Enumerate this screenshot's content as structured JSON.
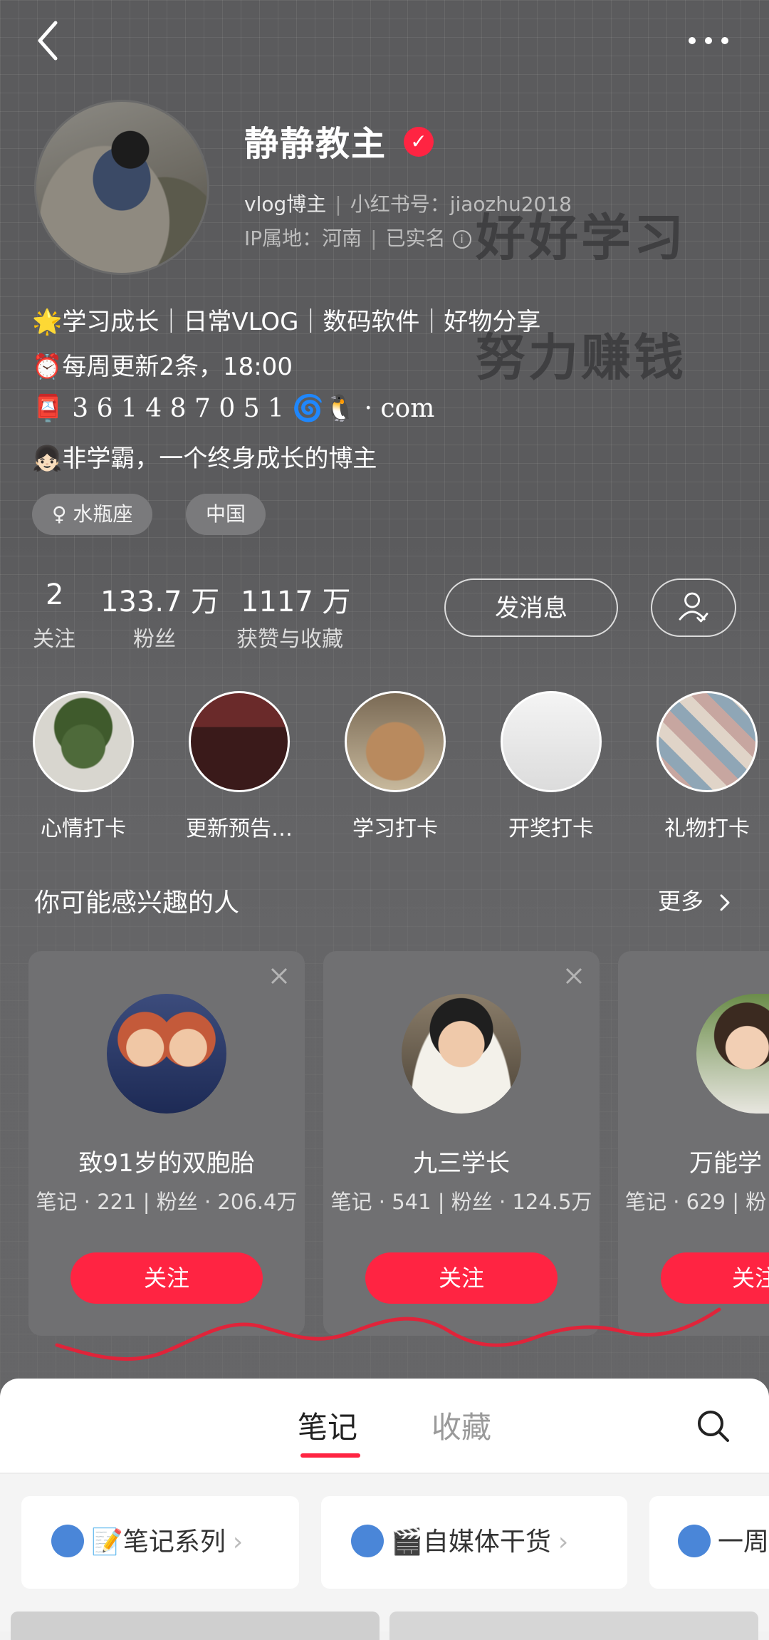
{
  "header": {
    "back_icon": "chevron-left-icon",
    "more_icon": "more-dots-icon"
  },
  "profile": {
    "name": "静静教主",
    "verified_icon": "verified-check-icon",
    "role": "vlog博主",
    "xhs_id_label": "小红书号：jiaozhu2018",
    "ip_label": "IP属地：河南",
    "realname": "已实名",
    "info_icon": "info-circle-icon",
    "background_text_1": "好好学习",
    "background_text_2": "努力赚钱",
    "bio": [
      "🌟学习成长｜日常VLOG｜数码软件｜好物分享",
      "⏰每周更新2条，18:00",
      "📮 3 6 1 4 8 7 0 5 1 🌀🐧 · com",
      "👧🏻非学霸，一个终身成长的博主"
    ],
    "tags": [
      "♀ 水瓶座",
      "中国"
    ]
  },
  "stats": [
    {
      "value": "2",
      "label": "关注"
    },
    {
      "value": "133.7 万",
      "label": "粉丝"
    },
    {
      "value": "1117 万",
      "label": "获赞与收藏"
    }
  ],
  "actions": {
    "message_label": "发消息",
    "follow_icon": "user-check-icon"
  },
  "highlights": [
    {
      "label": "心情打卡"
    },
    {
      "label": "更新预告…"
    },
    {
      "label": "学习打卡"
    },
    {
      "label": "开奖打卡"
    },
    {
      "label": "礼物打卡"
    }
  ],
  "recommend": {
    "title": "你可能感兴趣的人",
    "more_label": "更多",
    "cards": [
      {
        "name": "致91岁的双胞胎",
        "stats": "笔记 · 221 | 粉丝 · 206.4万",
        "button": "关注"
      },
      {
        "name": "九三学长",
        "stats": "笔记 · 541 | 粉丝 · 124.5万",
        "button": "关注"
      },
      {
        "name": "万能学",
        "stats": "笔记 · 629 | 粉",
        "button": "关注"
      }
    ]
  },
  "tabs": {
    "notes": "笔记",
    "collections": "收藏",
    "search_icon": "search-icon"
  },
  "collections": [
    {
      "label": "📝笔记系列"
    },
    {
      "label": "🎬自媒体干货"
    },
    {
      "label": "一周"
    }
  ],
  "colors": {
    "accent": "#ff2442",
    "background": "#5b5b5d"
  }
}
